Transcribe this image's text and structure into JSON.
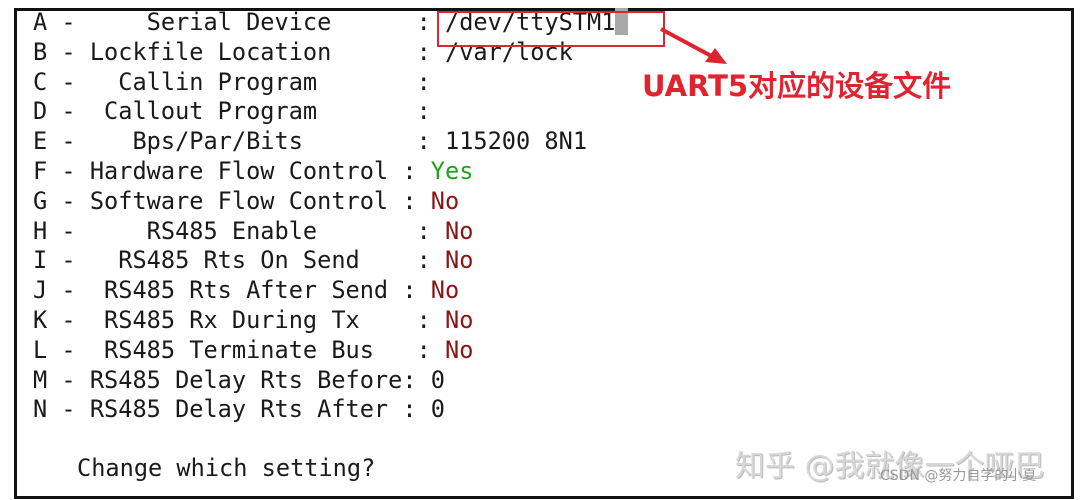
{
  "settings": [
    {
      "key": "A",
      "label": "    Serial Device      ",
      "value": "/dev/ttySTM1",
      "style": "normal"
    },
    {
      "key": "B",
      "label": "Lockfile Location      ",
      "value": "/var/lock",
      "style": "normal"
    },
    {
      "key": "C",
      "label": "  Callin Program       ",
      "value": "",
      "style": "normal"
    },
    {
      "key": "D",
      "label": " Callout Program       ",
      "value": "",
      "style": "normal"
    },
    {
      "key": "E",
      "label": "   Bps/Par/Bits        ",
      "value": "115200 8N1",
      "style": "normal"
    },
    {
      "key": "F",
      "label": "Hardware Flow Control ",
      "value": "Yes",
      "style": "yes"
    },
    {
      "key": "G",
      "label": "Software Flow Control ",
      "value": "No",
      "style": "no"
    },
    {
      "key": "H",
      "label": "    RS485 Enable       ",
      "value": "No",
      "style": "no"
    },
    {
      "key": "I",
      "label": "  RS485 Rts On Send    ",
      "value": "No",
      "style": "no"
    },
    {
      "key": "J",
      "label": " RS485 Rts After Send ",
      "value": "No",
      "style": "no"
    },
    {
      "key": "K",
      "label": " RS485 Rx During Tx    ",
      "value": "No",
      "style": "no"
    },
    {
      "key": "L",
      "label": " RS485 Terminate Bus   ",
      "value": "No",
      "style": "no"
    },
    {
      "key": "M",
      "label": "RS485 Delay Rts Before",
      "value": "0",
      "style": "normal"
    },
    {
      "key": "N",
      "label": "RS485 Delay Rts After ",
      "value": "0",
      "style": "normal"
    }
  ],
  "prompt": "Change which setting?",
  "annotation": {
    "text": "UART5对应的设备文件",
    "color": "#e0232e"
  },
  "watermarks": {
    "zhihu": "知乎 @我就像一个哑巴",
    "csdn": "CSDN @努力自学的小夏"
  },
  "colors": {
    "yes": "#1fa31f",
    "no": "#8b1414",
    "highlight": "#d42a34"
  }
}
